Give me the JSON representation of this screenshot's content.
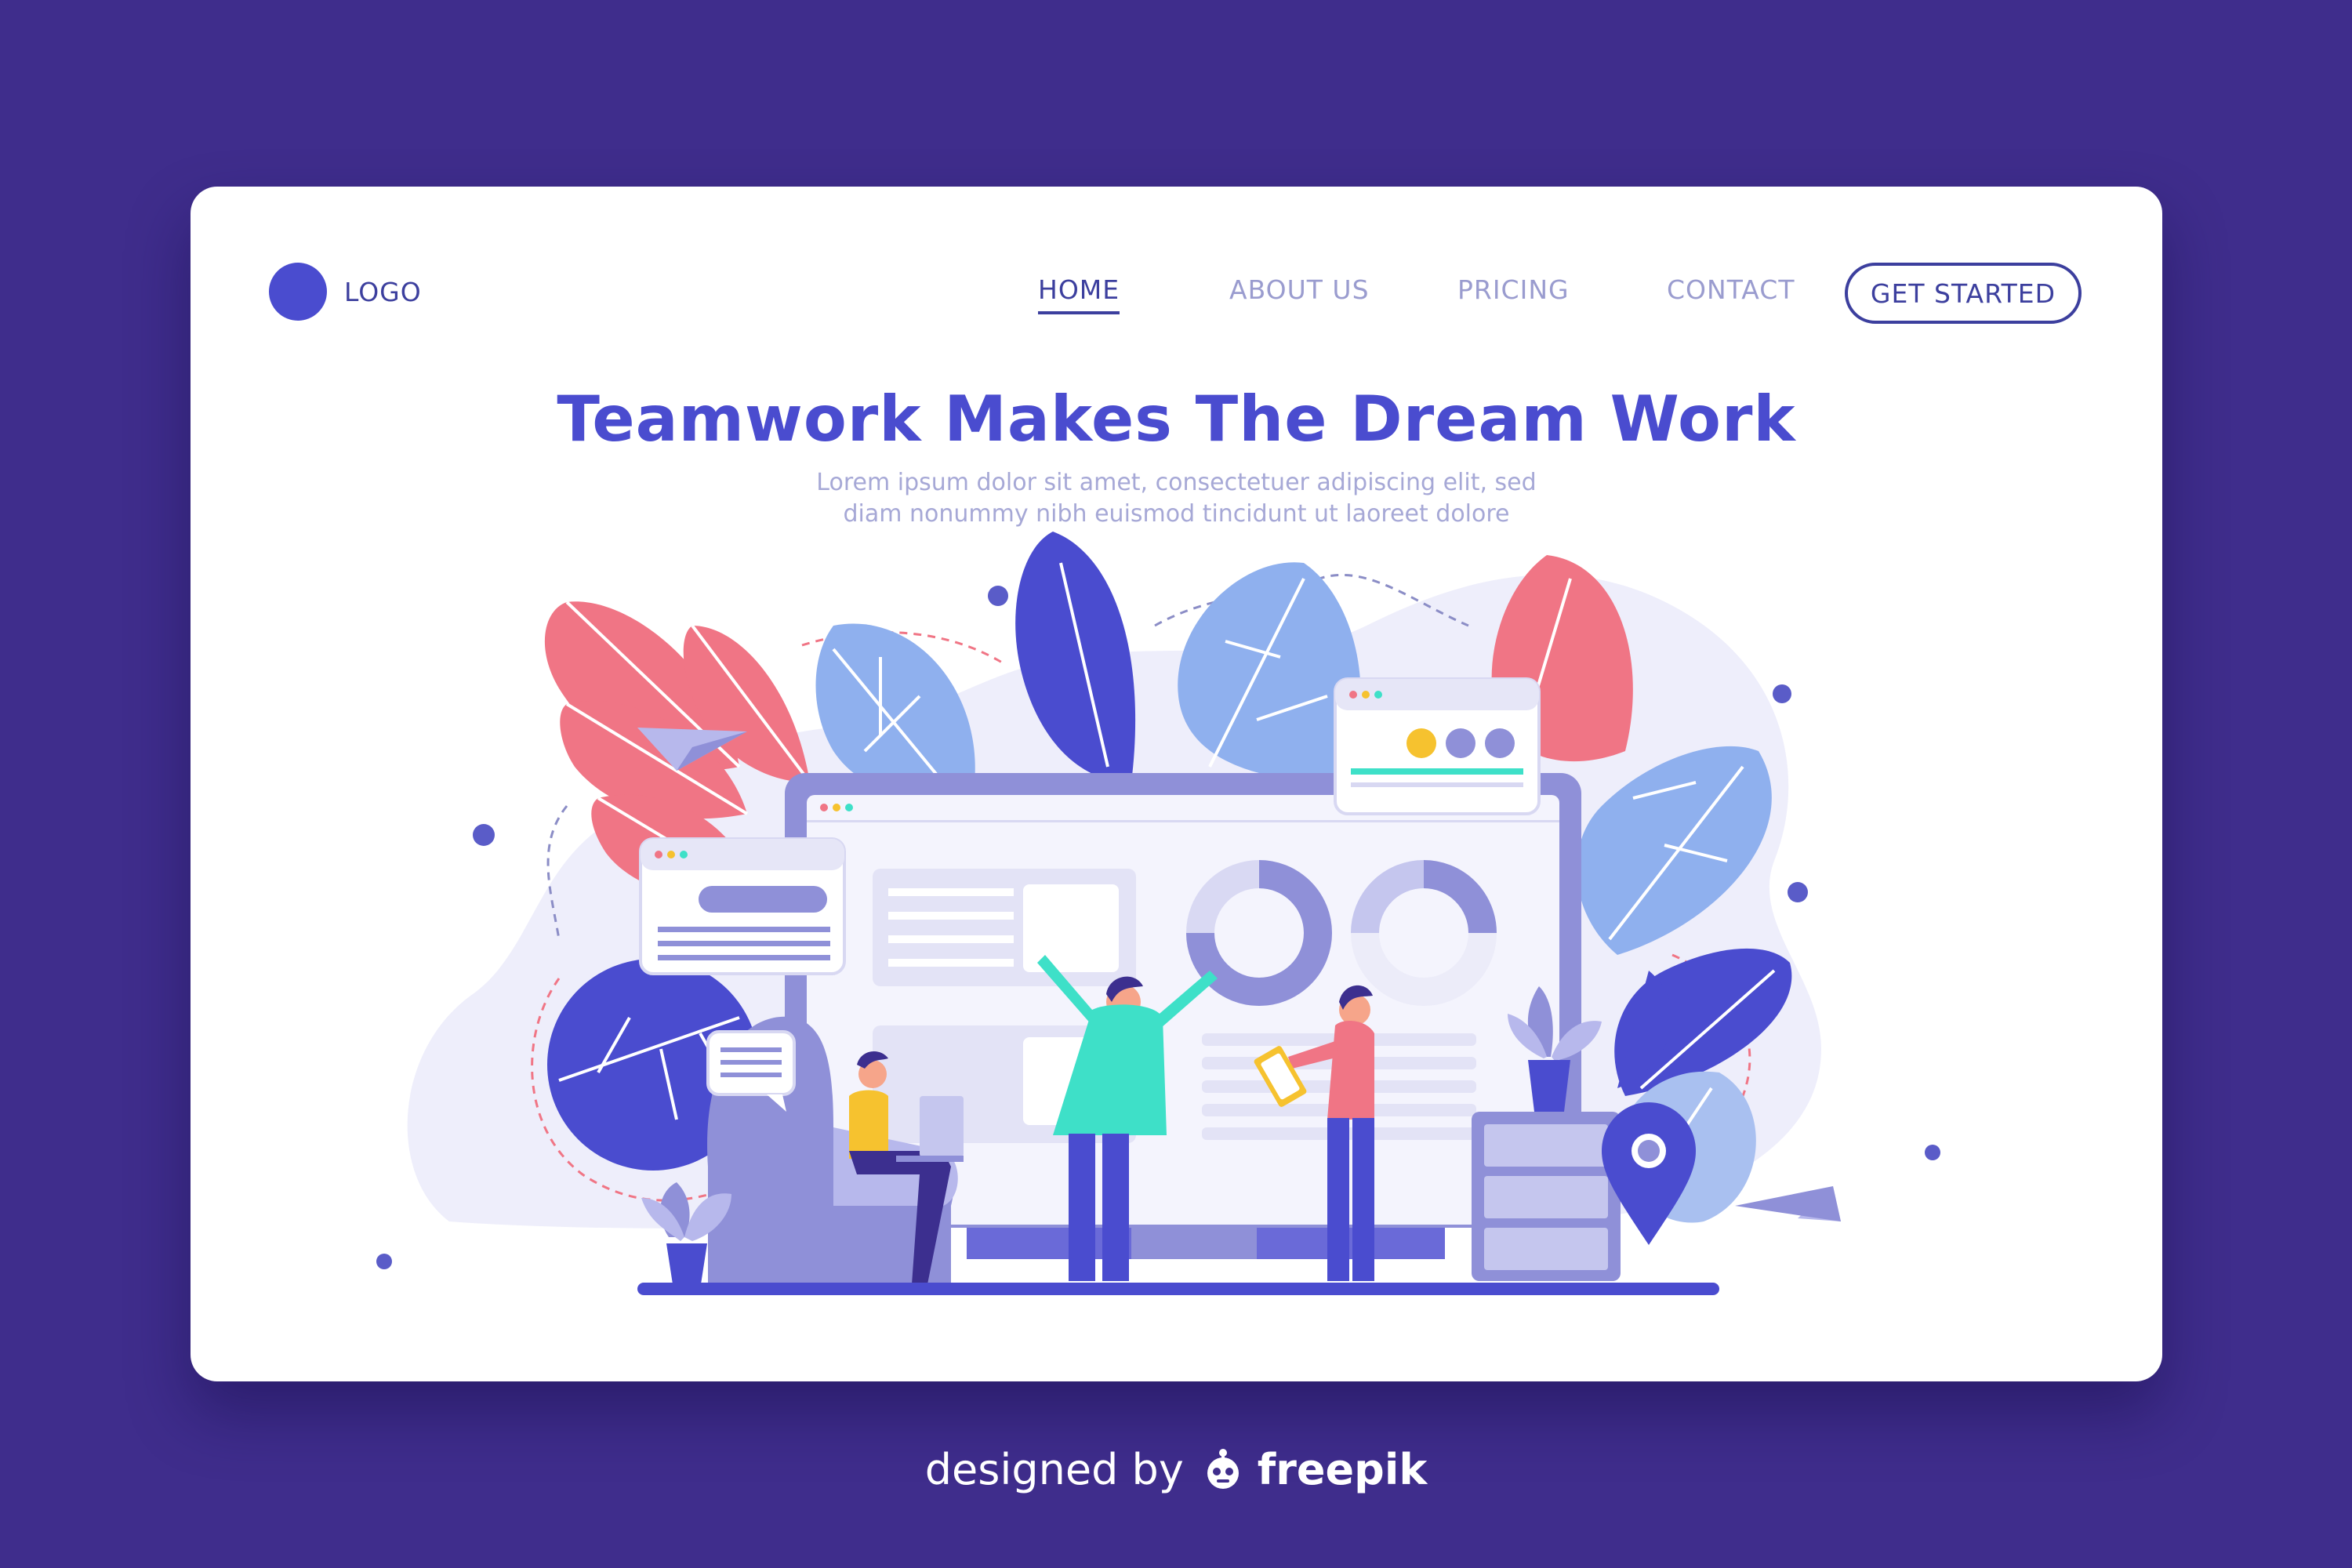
{
  "brand": {
    "logo_label": "LOGO"
  },
  "nav": {
    "items": [
      {
        "label": "HOME",
        "active": true
      },
      {
        "label": "ABOUT US",
        "active": false
      },
      {
        "label": "PRICING",
        "active": false
      },
      {
        "label": "CONTACT",
        "active": false
      }
    ],
    "cta_label": "GET STARTED"
  },
  "hero": {
    "title": "Teamwork Makes The Dream Work",
    "subtitle_line1": "Lorem ipsum dolor sit amet, consectetuer adipiscing elit, sed",
    "subtitle_line2": "diam nonummy nibh euismod tincidunt ut laoreet dolore"
  },
  "footer": {
    "prefix": "designed by",
    "brand": "freepik"
  },
  "colors": {
    "background": "#3f2d8c",
    "accent": "#4a4ccf",
    "text_dark": "#3c3f9e",
    "text_muted": "#9a9ccf",
    "leaf_pink": "#f07585",
    "leaf_blue": "#8fb0ee",
    "leaf_indigo": "#4a4ccf",
    "teal": "#3ee0c8",
    "yellow": "#f6c22f"
  },
  "icons": [
    "logo-dot",
    "paper-plane-icon",
    "map-pin-icon",
    "freepik-icon",
    "donut-chart-icon",
    "chat-bubble-icon"
  ]
}
